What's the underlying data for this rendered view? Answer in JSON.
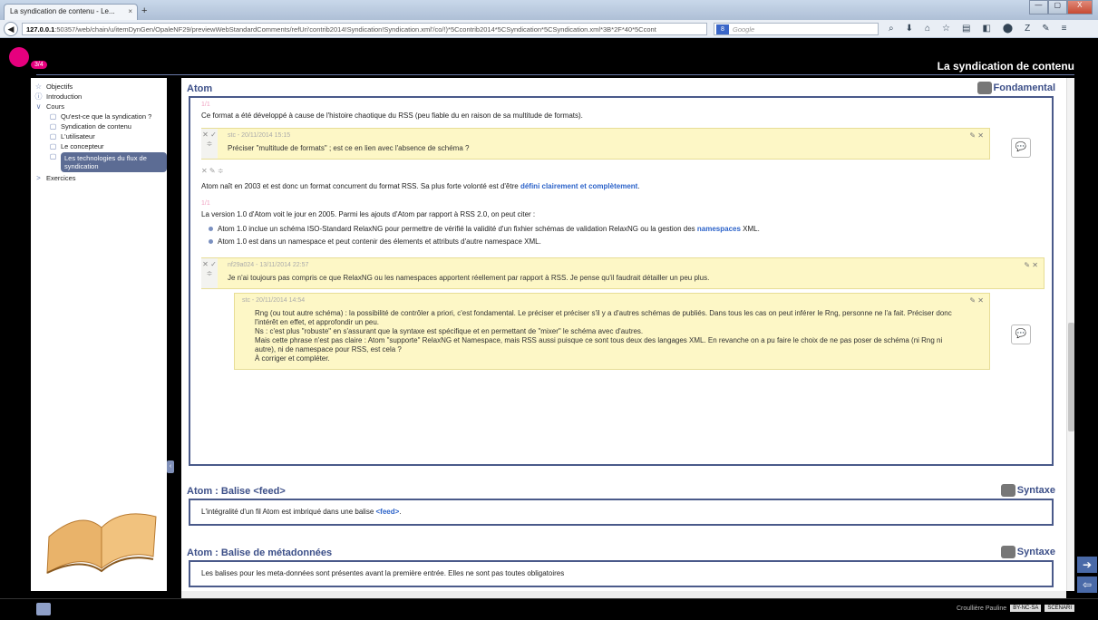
{
  "browser": {
    "tab_title": "La syndication de contenu - Le...",
    "tab_close": "×",
    "new_tab": "+",
    "window_buttons": [
      "—",
      "▢",
      "X"
    ],
    "back": "◀",
    "url_host": "127.0.0.1",
    "url_rest": ":50357/web/chain/u/itemDynGen/OpaleNF29/previewWebStandardComments/refUri'contrib2014!Syndication!Syndication.xml'/co/!)*5Ccontrib2014*5CSyndication*5CSyndication.xml*3B*2F*40*5Ccont",
    "url_controls": "▽ C",
    "search_placeholder": "Google",
    "search_engine": "8",
    "toolbar_icons": [
      "⌕",
      "⬇",
      "⌂",
      "☆",
      "▤",
      "◧",
      "⬤",
      "Z",
      "✎",
      "≡"
    ]
  },
  "header": {
    "page_counter": "3/4",
    "doc_title": "La syndication de contenu"
  },
  "sidebar": {
    "items": [
      {
        "icon": "☆",
        "label": "Objectifs"
      },
      {
        "icon": "ⓘ",
        "label": "Introduction"
      },
      {
        "icon": "∨",
        "label": "Cours"
      },
      {
        "icon": "▢",
        "label": "Qu'est-ce que la syndication ?"
      },
      {
        "icon": "▢",
        "label": "Syndication de contenu"
      },
      {
        "icon": "▢",
        "label": "L'utilisateur"
      },
      {
        "icon": "▢",
        "label": "Le concepteur"
      },
      {
        "icon": "▢",
        "label": "Les technologies du flux de syndication"
      },
      {
        "icon": ">",
        "label": "Exercices"
      }
    ],
    "collapse": "‹"
  },
  "section1": {
    "title": "Atom",
    "tag": "Fondamental",
    "p1_num": "1/1",
    "p1": "Ce format a été développé à cause de l'histoire chaotique du RSS (peu fiable du en raison de sa multitude de formats).",
    "comment1": {
      "meta": "stc - 20/11/2014 15:15",
      "body": "Préciser \"multitude de formats\" ; est ce en lien avec l'absence de schéma ?",
      "controls": "✎ ✕",
      "side": "✕ ✓ ≑"
    },
    "inline_controls": "✕ ✎ ≑",
    "p2_start": "Atom naît en 2003 et est donc un format concurrent du format RSS. Sa plus forte volonté est d'être ",
    "p2_link": "défini clairement et complètement",
    "p2_end": ".",
    "p3_num": "1/1",
    "p3": "La version 1.0 d'Atom voit le jour en 2005. Parmi les ajouts d'Atom par rapport à RSS 2.0, on peut citer :",
    "bullet1_start": "Atom 1.0 inclue un schéma ISO-Standard RelaxNG pour permettre de vérifié la validité d'un fixhier schémas de validation RelaxNG ou la gestion des ",
    "bullet1_link": "namespaces",
    "bullet1_end": " XML.",
    "bullet2": "Atom 1.0 est dans un namespace et peut contenir des élements et attributs d'autre namespace XML.",
    "comment2": {
      "meta": "nf29a024 - 13/11/2014 22:57",
      "body": "Je n'ai toujours pas compris ce que RelaxNG ou les namespaces apportent réellement par rapport à RSS. Je pense qu'il faudrait détailler un peu plus.",
      "controls": "✎ ✕",
      "side": "✕ ✓ ≑"
    },
    "comment3": {
      "meta": "stc - 20/11/2014 14:54",
      "lines": [
        "Rng (ou tout autre schéma) : la possibilité de contrôler a priori, c'est fondamental. Le préciser et préciser s'il y a d'autres schémas de publiés. Dans tous les cas on peut inférer le Rng, personne ne l'a fait. Préciser donc l'intérêt en effet, et approfondir un peu.",
        "Ns : c'est plus \"robuste\" en s'assurant que la syntaxe est spécifique et en permettant de \"mixer\" le schéma avec d'autres.",
        "Mais cette phrase n'est pas claire : Atom \"supporte\" RelaxNG et Namespace, mais RSS  aussi puisque ce sont tous deux des langages XML. En revanche on a pu faire le choix de ne pas poser de schéma (ni Rng ni autre), ni de namespace pour RSS, est cela ?",
        "À corriger et compléter."
      ],
      "controls": "✎ ✕"
    },
    "bubble": "💬"
  },
  "section2": {
    "title": "Atom : Balise <feed>",
    "tag": "Syntaxe",
    "text_start": "L'intégralité d'un fil Atom est imbriqué dans une balise ",
    "text_link": "<feed>",
    "text_end": "."
  },
  "section3": {
    "title": "Atom : Balise de métadonnées",
    "tag": "Syntaxe",
    "text": "Les balises pour les meta-données sont présentes avant la première entrée. Elles ne sont pas toutes obligatoires"
  },
  "nav": {
    "next": "➔",
    "prev": "⇦"
  },
  "footer": {
    "author": "Croullière Pauline",
    "license": "BY-NC-SA",
    "badge2": "SCENARI"
  },
  "colors": {
    "accent": "#3c4f88",
    "link": "#2b62c9",
    "comment_bg": "#fdf7c6",
    "logo": "#e6007e"
  }
}
